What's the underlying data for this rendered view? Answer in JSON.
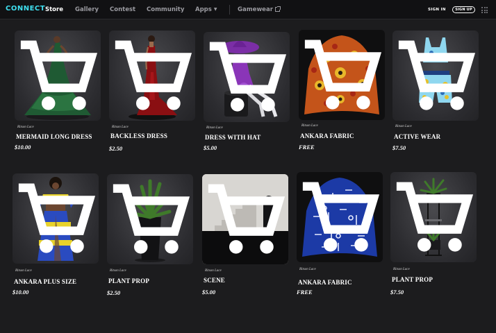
{
  "nav": {
    "logo": "CONNECT",
    "items": [
      {
        "label": "Store",
        "active": true
      },
      {
        "label": "Gallery",
        "active": false
      },
      {
        "label": "Contest",
        "active": false
      },
      {
        "label": "Community",
        "active": false
      },
      {
        "label": "Apps",
        "active": false
      }
    ],
    "gamewear": "Gamewear",
    "signin": "SIGN IN",
    "signup": "SIGN UP"
  },
  "products": [
    {
      "seller": "Ritson Lace",
      "name": "MERMAID LONG DRESS",
      "price": "$10.00",
      "icon": "green-gown-image"
    },
    {
      "seller": "Ritson Lace",
      "name": "BACKLESS  DRESS",
      "price": "$2.50",
      "icon": "red-dress-image"
    },
    {
      "seller": "Ritson Lace",
      "name": "DRESS WITH HAT",
      "price": "$5.00",
      "icon": "purple-dress-hat-image"
    },
    {
      "seller": "Ritson Lace",
      "name": "ANKARA FABRIC",
      "price": "FREE",
      "icon": "ankara-fabric-orange-image"
    },
    {
      "seller": "Ritson Lace",
      "name": "ACTIVE WEAR",
      "price": "$7.50",
      "icon": "active-wear-image"
    },
    {
      "seller": "Ritson Lace",
      "name": "ANKARA PLUS SIZE",
      "price": "$10.00",
      "icon": "ankara-dress-image"
    },
    {
      "seller": "Ritson Lace",
      "name": "PLANT PROP",
      "price": "$2.50",
      "icon": "potted-plant-image"
    },
    {
      "seller": "Ritson Lace",
      "name": "SCENE",
      "price": "$5.00",
      "icon": "stairs-scene-image"
    },
    {
      "seller": "Ritson Lace",
      "name": "ANKARA FABRIC",
      "price": "FREE",
      "icon": "ankara-fabric-blue-image"
    },
    {
      "seller": "Ritson Lace",
      "name": "PLANT PROP",
      "price": "$7.50",
      "icon": "plant-stand-image"
    }
  ],
  "colors": {
    "background": "#1c1c1e",
    "topbar": "#111113",
    "logo": "#3fe0f0"
  }
}
